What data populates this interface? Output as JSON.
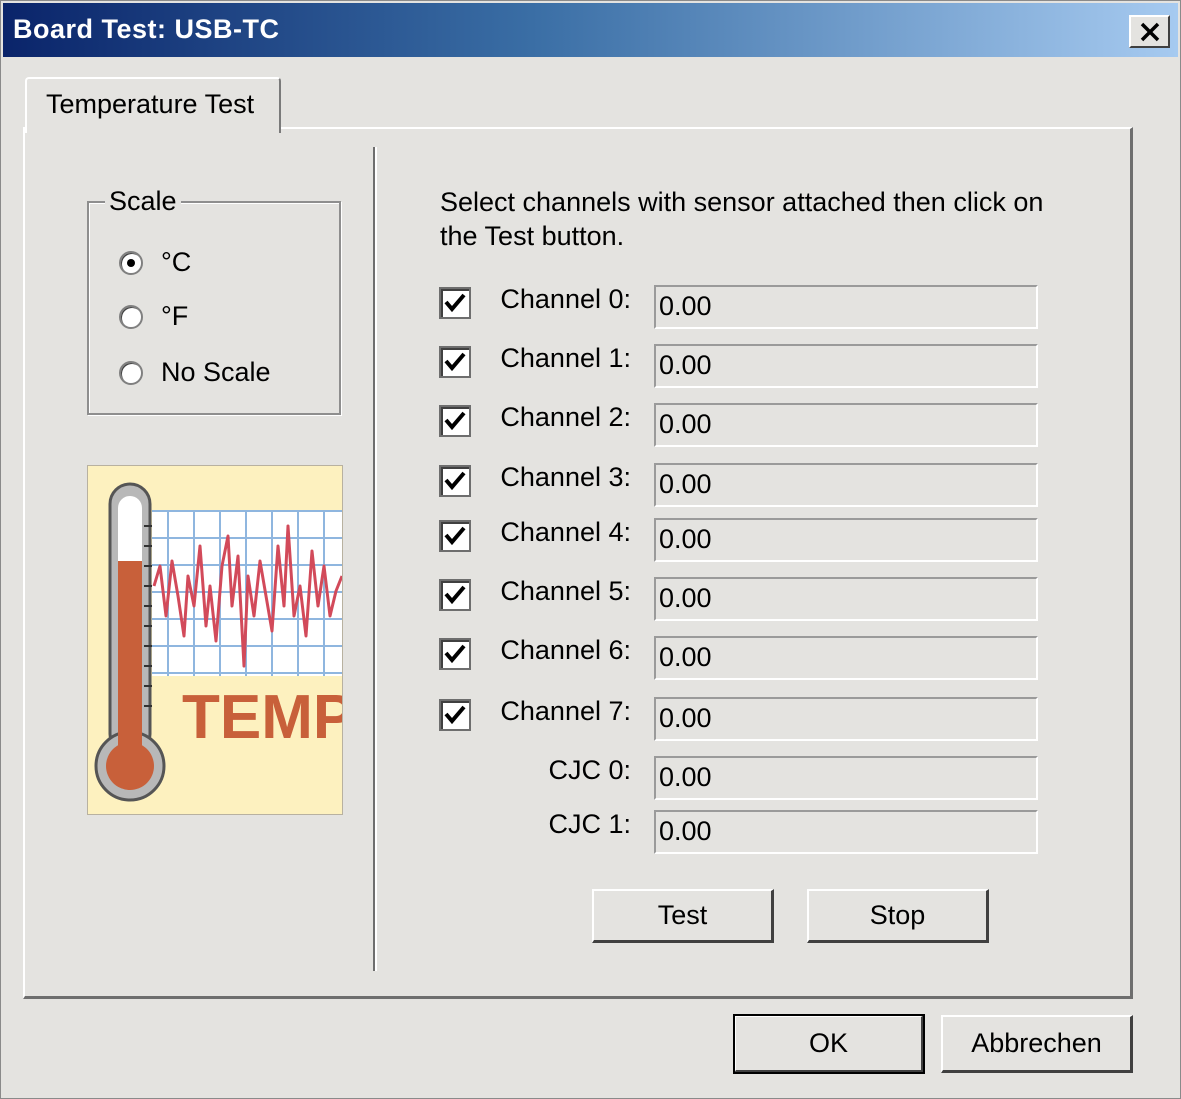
{
  "window": {
    "title": "Board Test: USB-TC"
  },
  "tabs": [
    {
      "label": "Temperature Test"
    }
  ],
  "scale": {
    "legend": "Scale",
    "options": [
      {
        "label": "°C",
        "selected": true
      },
      {
        "label": "°F",
        "selected": false
      },
      {
        "label": "No Scale",
        "selected": false
      }
    ]
  },
  "logo": {
    "text": "TEMP"
  },
  "instructions": "Select channels with sensor attached then click on the Test button.",
  "channels": [
    {
      "label": "Channel 0:",
      "value": "0.00",
      "checked": true
    },
    {
      "label": "Channel 1:",
      "value": "0.00",
      "checked": true
    },
    {
      "label": "Channel 2:",
      "value": "0.00",
      "checked": true
    },
    {
      "label": "Channel 3:",
      "value": "0.00",
      "checked": true
    },
    {
      "label": "Channel 4:",
      "value": "0.00",
      "checked": true
    },
    {
      "label": "Channel 5:",
      "value": "0.00",
      "checked": true
    },
    {
      "label": "Channel 6:",
      "value": "0.00",
      "checked": true
    },
    {
      "label": "Channel 7:",
      "value": "0.00",
      "checked": true
    }
  ],
  "cjc": [
    {
      "label": "CJC 0:",
      "value": "0.00"
    },
    {
      "label": "CJC 1:",
      "value": "0.00"
    }
  ],
  "buttons": {
    "test": "Test",
    "stop": "Stop",
    "ok": "OK",
    "cancel": "Abbrechen"
  },
  "icons": [
    "close-icon",
    "checkmark-icon",
    "thermometer-icon"
  ],
  "colors": {
    "title_start": "#0a246a",
    "title_end": "#a6caf0",
    "temp_text": "#c8603a",
    "mercury": "#c8603a",
    "graph_line": "#d24a5a"
  }
}
